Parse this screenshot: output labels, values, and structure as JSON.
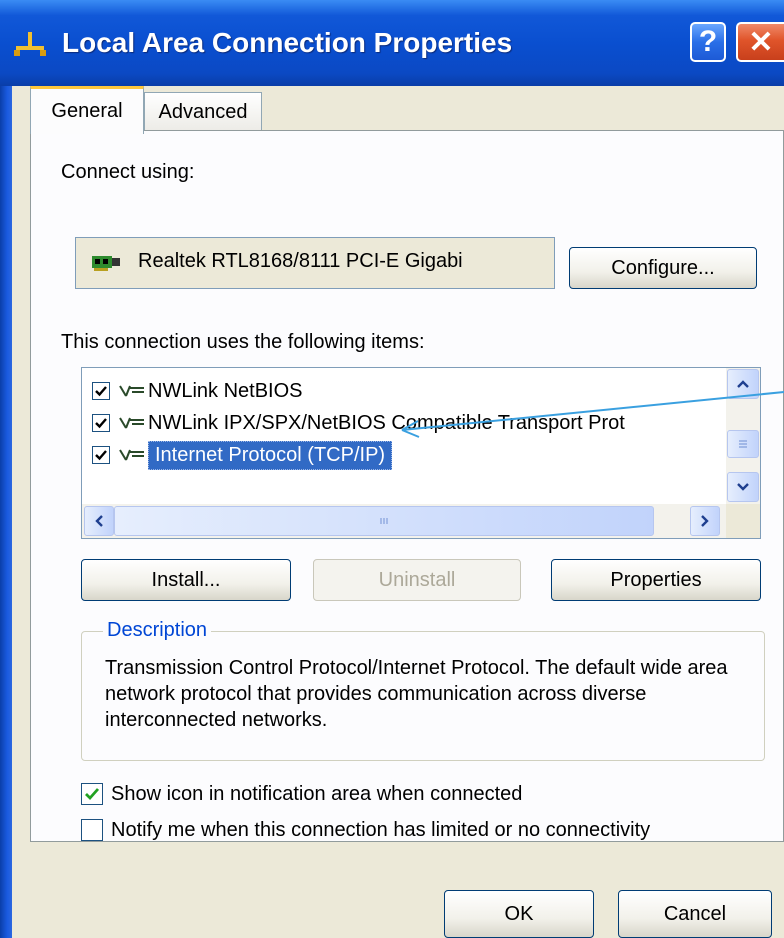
{
  "window": {
    "title": "Local Area Connection Properties",
    "help_label": "?",
    "close_label": "✕"
  },
  "tabs": [
    {
      "label": "General",
      "active": true
    },
    {
      "label": "Advanced",
      "active": false
    }
  ],
  "general": {
    "connect_using_label": "Connect using:",
    "adapter_name": "Realtek RTL8168/8111 PCI-E Gigabi",
    "configure_button": "Configure...",
    "items_label": "This connection uses the following items:",
    "items": [
      {
        "label": "NWLink NetBIOS",
        "checked": true,
        "selected": false
      },
      {
        "label": "NWLink IPX/SPX/NetBIOS Compatible Transport Prot",
        "checked": true,
        "selected": false
      },
      {
        "label": "Internet Protocol (TCP/IP)",
        "checked": true,
        "selected": true
      }
    ],
    "install_button": "Install...",
    "uninstall_button": "Uninstall",
    "properties_button": "Properties",
    "description_legend": "Description",
    "description_text": "Transmission Control Protocol/Internet Protocol. The default wide area network protocol that provides communication across diverse interconnected networks.",
    "show_icon_label": "Show icon in notification area when connected",
    "show_icon_checked": true,
    "notify_label": "Notify me when this connection has limited or no connectivity",
    "notify_checked": false
  },
  "footer": {
    "ok_button": "OK",
    "cancel_button": "Cancel"
  },
  "colors": {
    "titlebar": "#0a4fd0",
    "selection": "#316ac5",
    "face": "#ece9d8",
    "annotation_arrow": "#3aa0e0",
    "check_green": "#21a121"
  }
}
